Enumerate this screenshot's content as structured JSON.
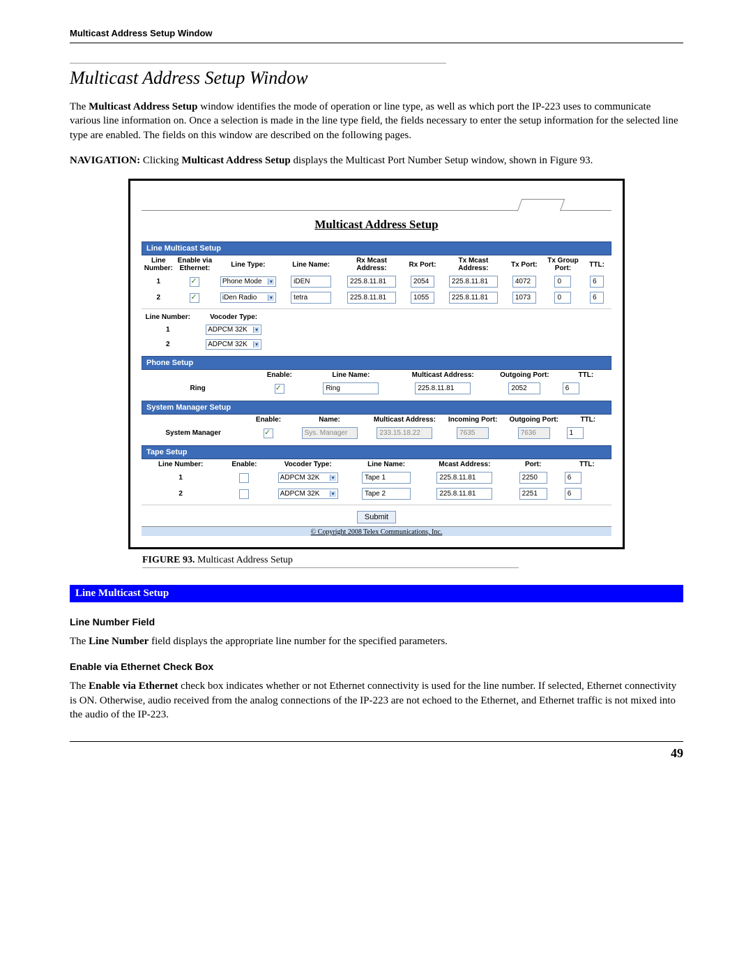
{
  "header": {
    "title": "Multicast Address Setup Window"
  },
  "section": {
    "title": "Multicast Address Setup Window",
    "p1_prefix": "The ",
    "p1_bold": "Multicast Address Setup",
    "p1_rest": " window identifies the mode of operation or line type, as well as which port the IP-223 uses to communicate various line information on. Once a selection is made in the line type field, the fields necessary to enter the setup information for the selected line type are enabled. The fields on this window are described on the following pages.",
    "nav_label": "NAVIGATION:",
    "nav_mid": "  Clicking ",
    "nav_bold": "Multicast Address Setup",
    "nav_rest": " displays the Multicast Port Number Setup window, shown in Figure 93."
  },
  "figure": {
    "title": "Multicast Address Setup",
    "line_setup": {
      "bar": "Line Multicast Setup",
      "headers": [
        "Line Number:",
        "Enable via Ethernet:",
        "Line Type:",
        "Line Name:",
        "Rx Mcast Address:",
        "Rx Port:",
        "Tx Mcast Address:",
        "Tx Port:",
        "Tx Group Port:",
        "TTL:"
      ],
      "rows": [
        {
          "num": "1",
          "enabled": true,
          "type": "Phone Mode",
          "name": "iDEN",
          "rxaddr": "225.8.11.81",
          "rxport": "2054",
          "txaddr": "225.8.11.81",
          "txport": "4072",
          "txgrp": "0",
          "ttl": "6"
        },
        {
          "num": "2",
          "enabled": true,
          "type": "iDen Radio",
          "name": "tetra",
          "rxaddr": "225.8.11.81",
          "rxport": "1055",
          "txaddr": "225.8.11.81",
          "txport": "1073",
          "txgrp": "0",
          "ttl": "6"
        }
      ]
    },
    "vocoder": {
      "headers": [
        "Line Number:",
        "Vocoder Type:"
      ],
      "rows": [
        {
          "num": "1",
          "type": "ADPCM 32K"
        },
        {
          "num": "2",
          "type": "ADPCM 32K"
        }
      ]
    },
    "phone_setup": {
      "bar": "Phone Setup",
      "headers": [
        "",
        "Enable:",
        "Line Name:",
        "Multicast Address:",
        "Outgoing Port:",
        "TTL:"
      ],
      "row": {
        "label": "Ring",
        "enabled": true,
        "name": "Ring",
        "addr": "225.8.11.81",
        "outport": "2052",
        "ttl": "6"
      }
    },
    "sysmgr_setup": {
      "bar": "System Manager Setup",
      "headers": [
        "",
        "Enable:",
        "Name:",
        "Multicast Address:",
        "Incoming Port:",
        "Outgoing Port:",
        "TTL:"
      ],
      "row": {
        "label": "System Manager",
        "enabled": true,
        "name": "Sys. Manager",
        "addr": "233.15.18.22",
        "inport": "7635",
        "outport": "7636",
        "ttl": "1"
      }
    },
    "tape_setup": {
      "bar": "Tape Setup",
      "headers": [
        "Line Number:",
        "Enable:",
        "Vocoder Type:",
        "Line Name:",
        "Mcast Address:",
        "Port:",
        "TTL:"
      ],
      "rows": [
        {
          "num": "1",
          "enabled": false,
          "type": "ADPCM 32K",
          "name": "Tape 1",
          "addr": "225.8.11.81",
          "port": "2250",
          "ttl": "6"
        },
        {
          "num": "2",
          "enabled": false,
          "type": "ADPCM 32K",
          "name": "Tape 2",
          "addr": "225.8.11.81",
          "port": "2251",
          "ttl": "6"
        }
      ]
    },
    "submit": "Submit",
    "copyright": "© Copyright 2008 Telex Communications, Inc.",
    "caption_label": "FIGURE 93.",
    "caption_text": "  Multicast Address Setup"
  },
  "blue_bar": "Line Multicast Setup",
  "field1": {
    "head": "Line Number Field",
    "p_prefix": "The ",
    "p_bold": "Line Number",
    "p_rest": " field displays the appropriate line number for the specified parameters."
  },
  "field2": {
    "head": "Enable via Ethernet Check Box",
    "p_prefix": "The ",
    "p_bold": "Enable via Ethernet",
    "p_rest": " check box indicates whether or not Ethernet connectivity is used for the line number. If selected, Ethernet connectivity is ON. Otherwise, audio received from the analog connections of the IP-223 are not echoed to the Ethernet, and Ethernet traffic is not mixed into the audio of the IP-223."
  },
  "page_number": "49"
}
